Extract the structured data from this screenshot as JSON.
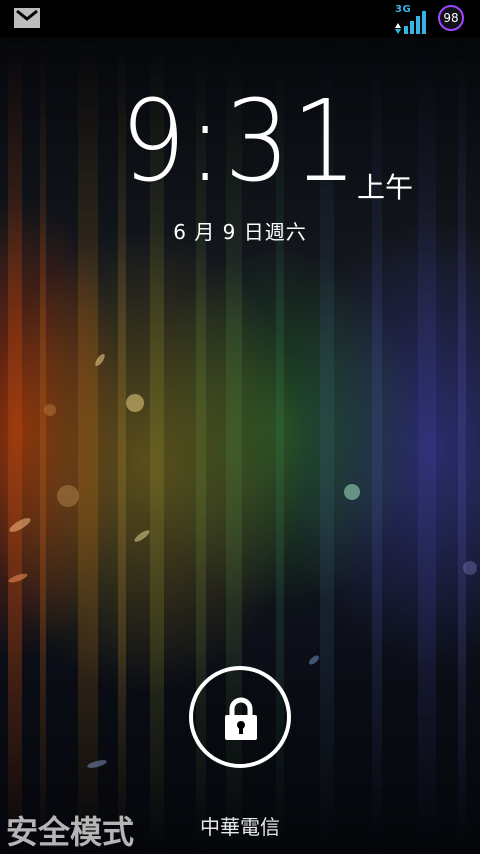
{
  "status_bar": {
    "notification_icon": "gmail-icon",
    "network_type": "3G",
    "signal_icon": "signal-bars-icon",
    "battery_percent": "98",
    "battery_color": "#a048ff"
  },
  "lockscreen": {
    "time": "9:31",
    "ampm": "上午",
    "date": "6 月 9 日週六",
    "unlock_icon": "lock-icon",
    "carrier": "中華電信",
    "safe_mode": "安全模式"
  }
}
